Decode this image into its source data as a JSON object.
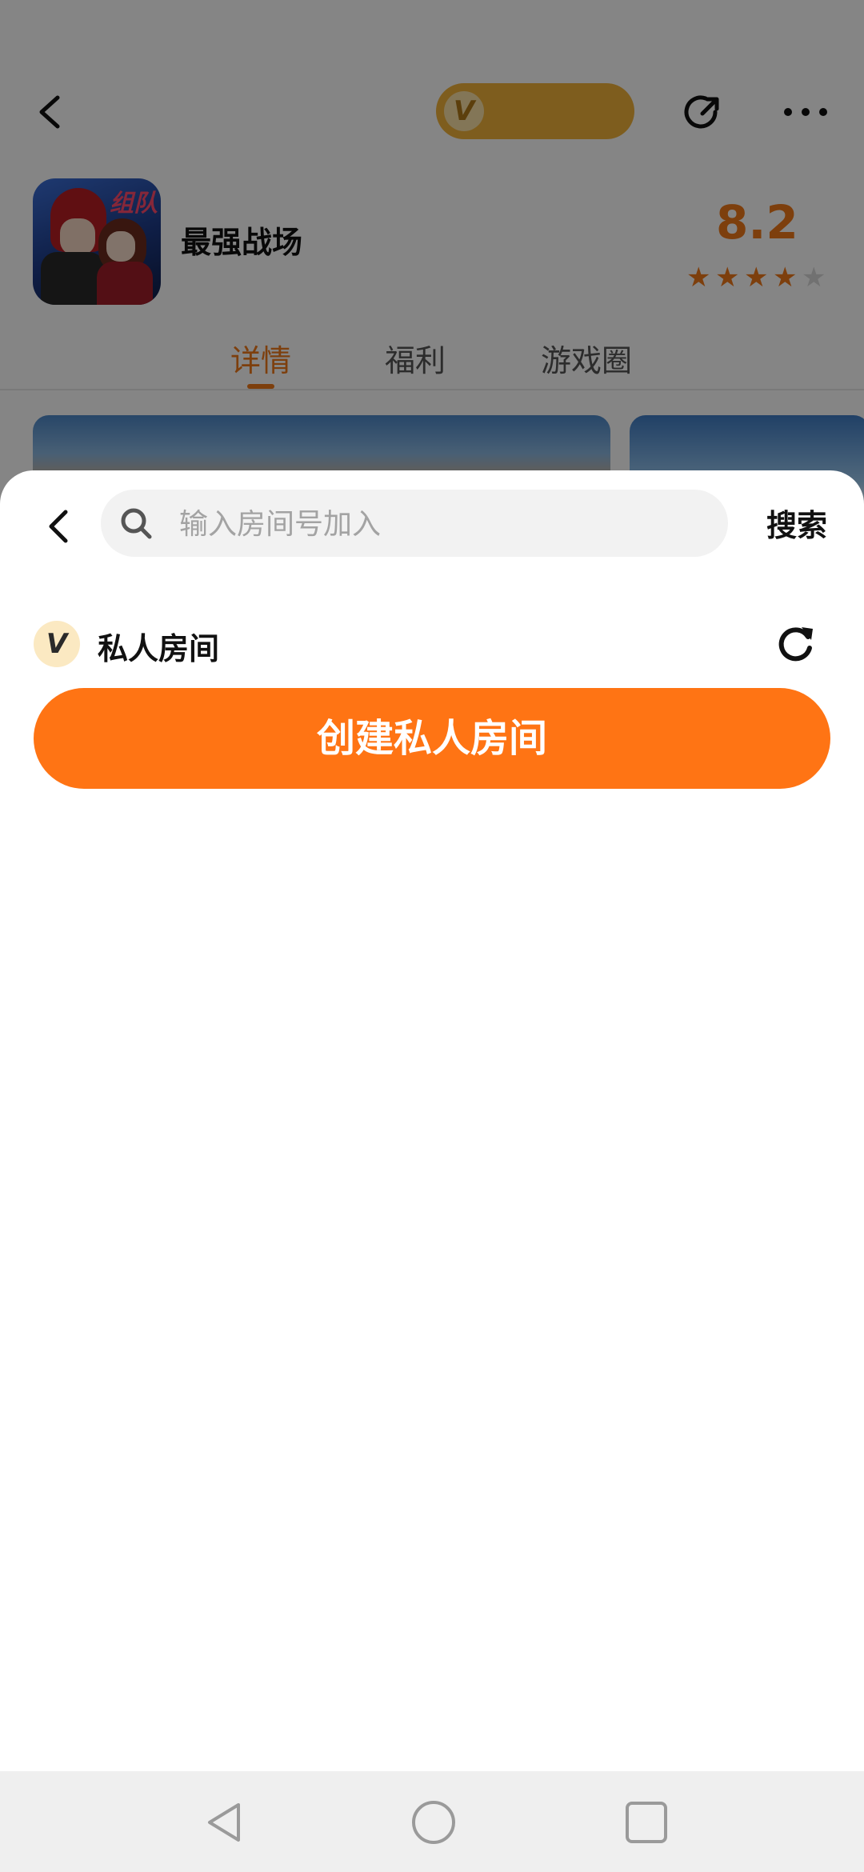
{
  "app": {
    "game_name": "最强战场",
    "rating": "8.2",
    "stars": {
      "filled": 4,
      "total": 5
    },
    "icon_tag": "组队",
    "vip_badge": "V",
    "tabs": [
      {
        "label": "详情",
        "active": true
      },
      {
        "label": "福利",
        "active": false
      },
      {
        "label": "游戏圈",
        "active": false
      }
    ],
    "accent_color": "#f07a1a"
  },
  "sheet": {
    "search": {
      "placeholder": "输入房间号加入",
      "value": "",
      "button_label": "搜索"
    },
    "room_section": {
      "badge": "V",
      "title": "私人房间"
    },
    "create_button_label": "创建私人房间",
    "button_color": "#ff7414"
  },
  "system_nav": {
    "icons": [
      "back-triangle-icon",
      "home-circle-icon",
      "recent-square-icon"
    ]
  }
}
